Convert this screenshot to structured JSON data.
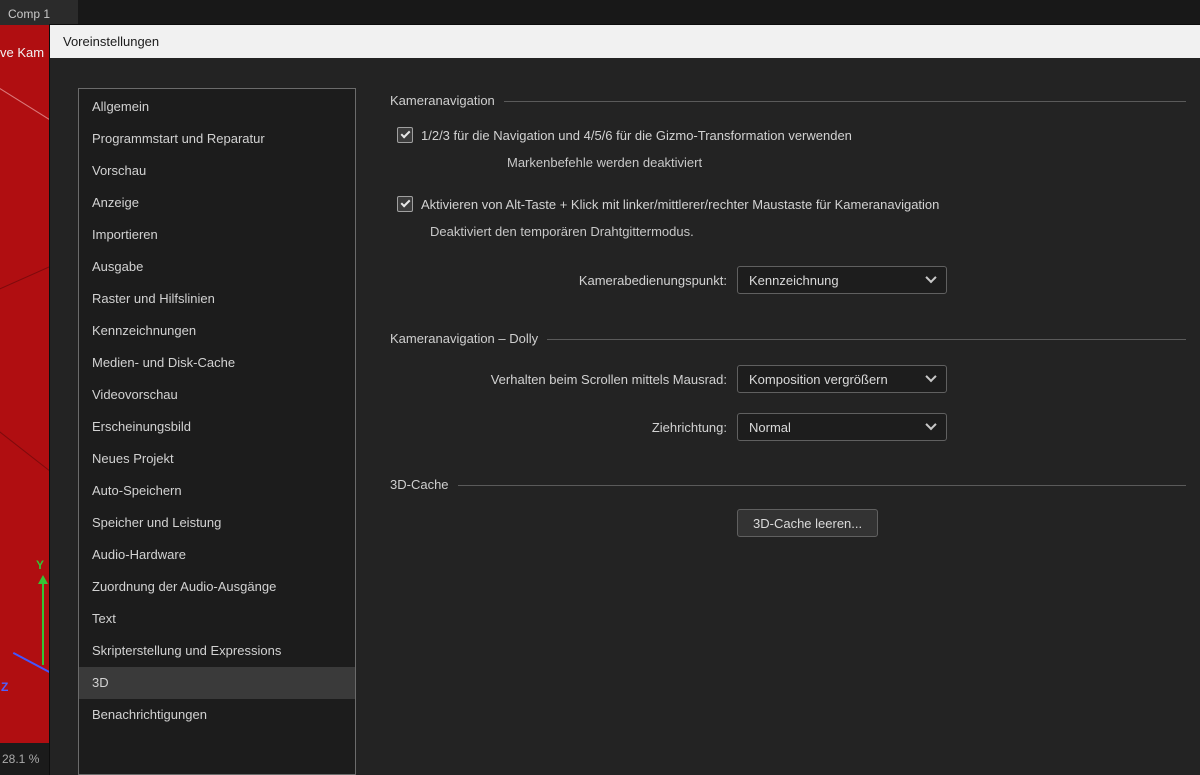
{
  "app": {
    "tab_label": "Comp 1",
    "viewer": {
      "camera_label": "ve Kam",
      "zoom_level": "28.1 %",
      "axis_y_label": "Y",
      "axis_z_label": "Z"
    }
  },
  "dialog": {
    "title": "Voreinstellungen",
    "sidebar": {
      "items": [
        {
          "label": "Allgemein",
          "selected": false
        },
        {
          "label": "Programmstart und Reparatur",
          "selected": false
        },
        {
          "label": "Vorschau",
          "selected": false
        },
        {
          "label": "Anzeige",
          "selected": false
        },
        {
          "label": "Importieren",
          "selected": false
        },
        {
          "label": "Ausgabe",
          "selected": false
        },
        {
          "label": "Raster und Hilfslinien",
          "selected": false
        },
        {
          "label": "Kennzeichnungen",
          "selected": false
        },
        {
          "label": "Medien- und Disk-Cache",
          "selected": false
        },
        {
          "label": "Videovorschau",
          "selected": false
        },
        {
          "label": "Erscheinungsbild",
          "selected": false
        },
        {
          "label": "Neues Projekt",
          "selected": false
        },
        {
          "label": "Auto-Speichern",
          "selected": false
        },
        {
          "label": "Speicher und Leistung",
          "selected": false
        },
        {
          "label": "Audio-Hardware",
          "selected": false
        },
        {
          "label": "Zuordnung der Audio-Ausgänge",
          "selected": false
        },
        {
          "label": "Text",
          "selected": false
        },
        {
          "label": "Skripterstellung und Expressions",
          "selected": false
        },
        {
          "label": "3D",
          "selected": true
        },
        {
          "label": "Benachrichtigungen",
          "selected": false
        }
      ]
    },
    "sections": {
      "camera_nav": {
        "title": "Kameranavigation",
        "checkbox1": {
          "label": "1/2/3 für die Navigation und 4/5/6 für die Gizmo-Transformation verwenden",
          "checked": true,
          "note": "Markenbefehle werden deaktiviert"
        },
        "checkbox2": {
          "label": "Aktivieren von Alt-Taste + Klick mit linker/mittlerer/rechter Maustaste für Kameranavigation",
          "checked": true,
          "note": "Deaktiviert den temporären Drahtgittermodus."
        },
        "control_point": {
          "label": "Kamerabedienungspunkt:",
          "value": "Kennzeichnung"
        }
      },
      "dolly": {
        "title": "Kameranavigation – Dolly",
        "scroll": {
          "label": "Verhalten beim Scrollen mittels Mausrad:",
          "value": "Komposition vergrößern"
        },
        "direction": {
          "label": "Ziehrichtung:",
          "value": "Normal"
        }
      },
      "cache": {
        "title": "3D-Cache",
        "button_label": "3D-Cache leeren..."
      }
    }
  },
  "colors": {
    "dialog_bg": "#232323",
    "titlebar_bg": "#f1f1f1",
    "sidebar_bg": "#1c1c1c",
    "selected_item_bg": "#3a3a3a",
    "viewer_red": "#b00e11",
    "axis_y_green": "#35c435",
    "axis_z_blue": "#4f5fff",
    "text_light": "#d2d2d2"
  }
}
